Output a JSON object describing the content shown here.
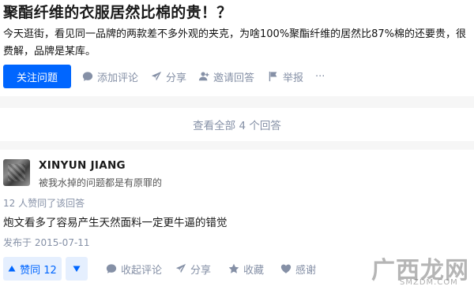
{
  "question": {
    "title": "聚酯纤维的衣服居然比棉的贵！？",
    "detail": "今天逛街，看见同一品牌的两款差不多外观的夹克，为啥100%聚酯纤维的居然比87%棉的还要贵，很费解，品牌是某库。",
    "follow_label": "关注问题",
    "actions": {
      "comment": "添加评论",
      "share": "分享",
      "invite": "邀请回答",
      "report": "举报",
      "more": "···"
    }
  },
  "view_all": "查看全部 4 个回答",
  "answer": {
    "author_name": "XINYUN JIANG",
    "author_bio": "被我水掉的问题都是有原罪的",
    "upvote_count": "12 人赞同了该回答",
    "content": "炮文看多了容易产生天然面料一定更牛逼的错觉",
    "publish_date": "发布于 2015-07-11",
    "vote_label": "赞同 12",
    "actions": {
      "collapse_comments": "收起评论",
      "share": "分享",
      "collect": "收藏",
      "thanks": "感谢"
    }
  },
  "watermark": {
    "main": "广西龙网",
    "sub": "SMZDM.COM"
  },
  "colors": {
    "accent": "#0066ff",
    "muted": "#8590a6",
    "vote_bg": "#e5effe"
  }
}
